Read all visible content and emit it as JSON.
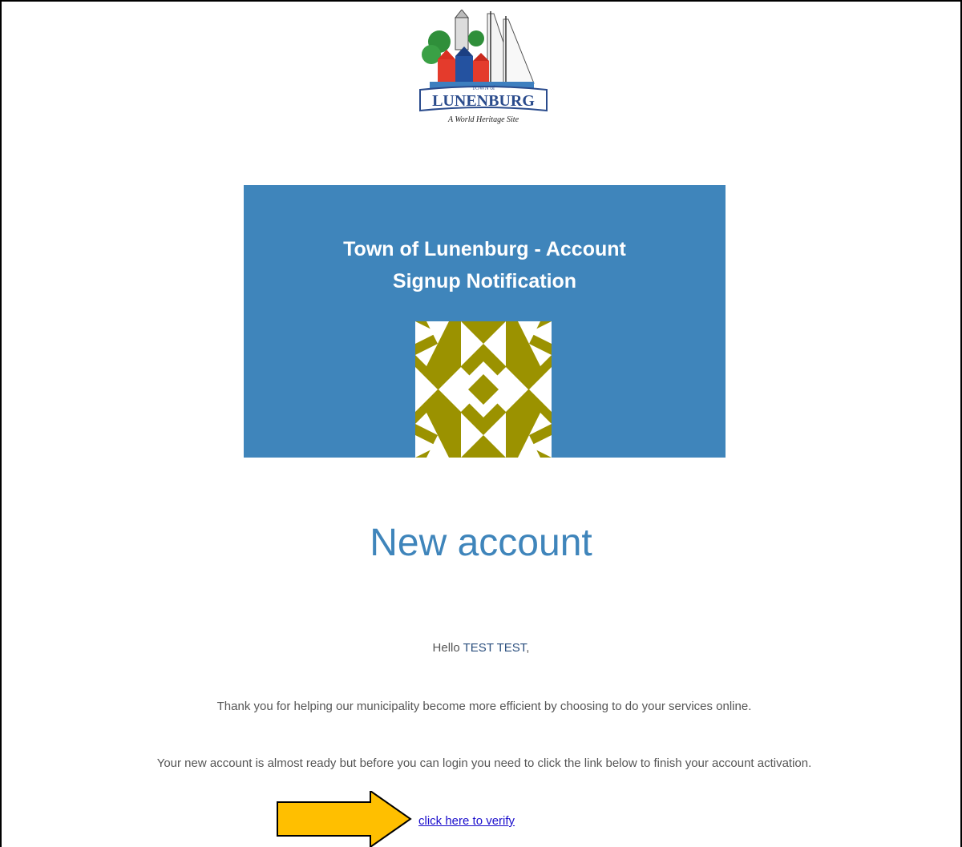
{
  "logo": {
    "top_text": "TOWN of",
    "name": "LUNENBURG",
    "tagline": "A World Heritage Site"
  },
  "banner": {
    "title_line1": "Town of Lunenburg - Account",
    "title_line2": "Signup Notification",
    "color": "#3f85bb",
    "avatar_color": "#9b9200"
  },
  "main": {
    "heading": "New account",
    "greeting_prefix": "Hello",
    "user_name": "TEST TEST",
    "greeting_suffix": ",",
    "paragraph1": "Thank you for helping our municipality become more efficient by choosing to do your services online.",
    "paragraph2": "Your new account is almost ready but before you can login you need to click the link below to finish your account activation.",
    "verify_link": "click here to verify"
  },
  "annotation": {
    "arrow_color": "#ffbf00",
    "arrow_icon": "arrow-right-icon"
  }
}
